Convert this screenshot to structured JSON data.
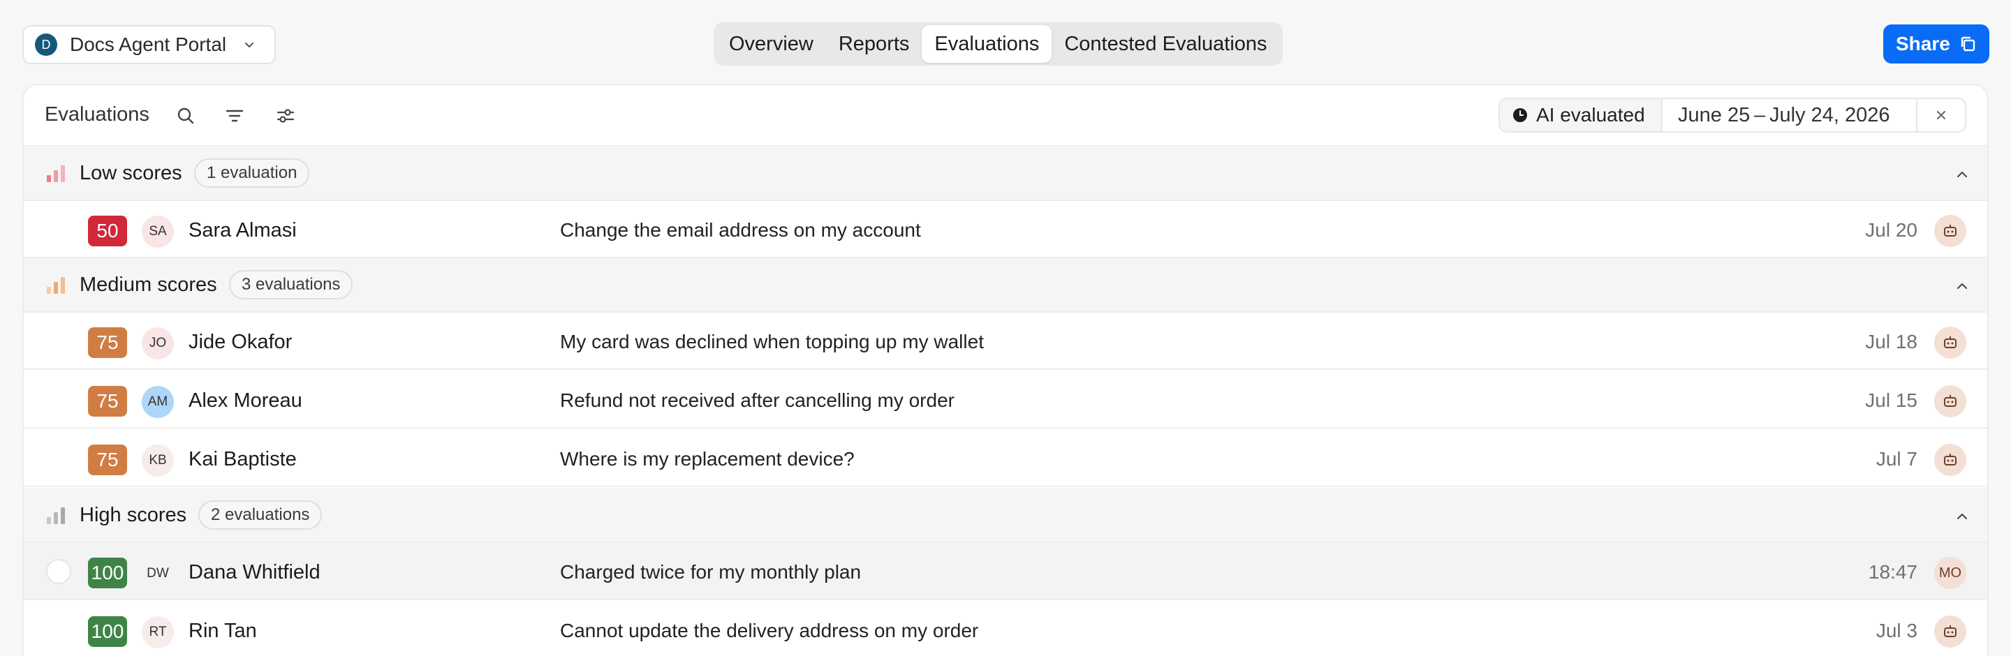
{
  "workspace": {
    "initial": "D",
    "name": "Docs Agent Portal"
  },
  "tabs": [
    {
      "label": "Overview",
      "active": false
    },
    {
      "label": "Reports",
      "active": false
    },
    {
      "label": "Evaluations",
      "active": true
    },
    {
      "label": "Contested Evaluations",
      "active": false
    }
  ],
  "share": {
    "label": "Share",
    "icon": "copy-icon"
  },
  "panel": {
    "title": "Evaluations",
    "toolbar_icons": [
      "search-icon",
      "filter-lines-icon",
      "sliders-icon"
    ],
    "filter": {
      "mode_label": "AI evaluated",
      "date_range": "June 25 – July 24, 2026",
      "clear_icon": "close-icon"
    }
  },
  "colors": {
    "accent": "#0a6cf5",
    "score_low": "#d1283a",
    "score_medium": "#d07d43",
    "score_high": "#3f8446",
    "bars_low": "#ef7d86",
    "bars_medium": "#f4a86d",
    "bars_high": "#a9a9a9"
  },
  "groups": [
    {
      "title": "Low scores",
      "count": "1 evaluation",
      "level": "low",
      "rows": [
        {
          "score": "50",
          "initials": "SA",
          "name": "Sara Almasi",
          "subject": "Change the email address on my account",
          "date": "Jul 20",
          "agent": "bot"
        }
      ]
    },
    {
      "title": "Medium scores",
      "count": "3 evaluations",
      "level": "medium",
      "rows": [
        {
          "score": "75",
          "initials": "JO",
          "name": "Jide Okafor",
          "subject": "My card was declined when topping up my wallet",
          "date": "Jul 18",
          "agent": "bot"
        },
        {
          "score": "75",
          "initials": "AM",
          "name": "Alex Moreau",
          "subject": "Refund not received after cancelling my order",
          "date": "Jul 15",
          "agent": "bot"
        },
        {
          "score": "75",
          "initials": "KB",
          "name": "Kai Baptiste",
          "subject": "Where is my replacement device?",
          "date": "Jul 7",
          "agent": "bot"
        }
      ]
    },
    {
      "title": "High scores",
      "count": "2 evaluations",
      "level": "high",
      "rows": [
        {
          "score": "100",
          "initials": "DW",
          "name": "Dana Whitfield",
          "subject": "Charged twice for my monthly plan",
          "date": "18:47",
          "agent": "MO"
        },
        {
          "score": "100",
          "initials": "RT",
          "name": "Rin Tan",
          "subject": "Cannot update the delivery address on my order",
          "date": "Jul 3",
          "agent": "bot"
        }
      ]
    }
  ]
}
